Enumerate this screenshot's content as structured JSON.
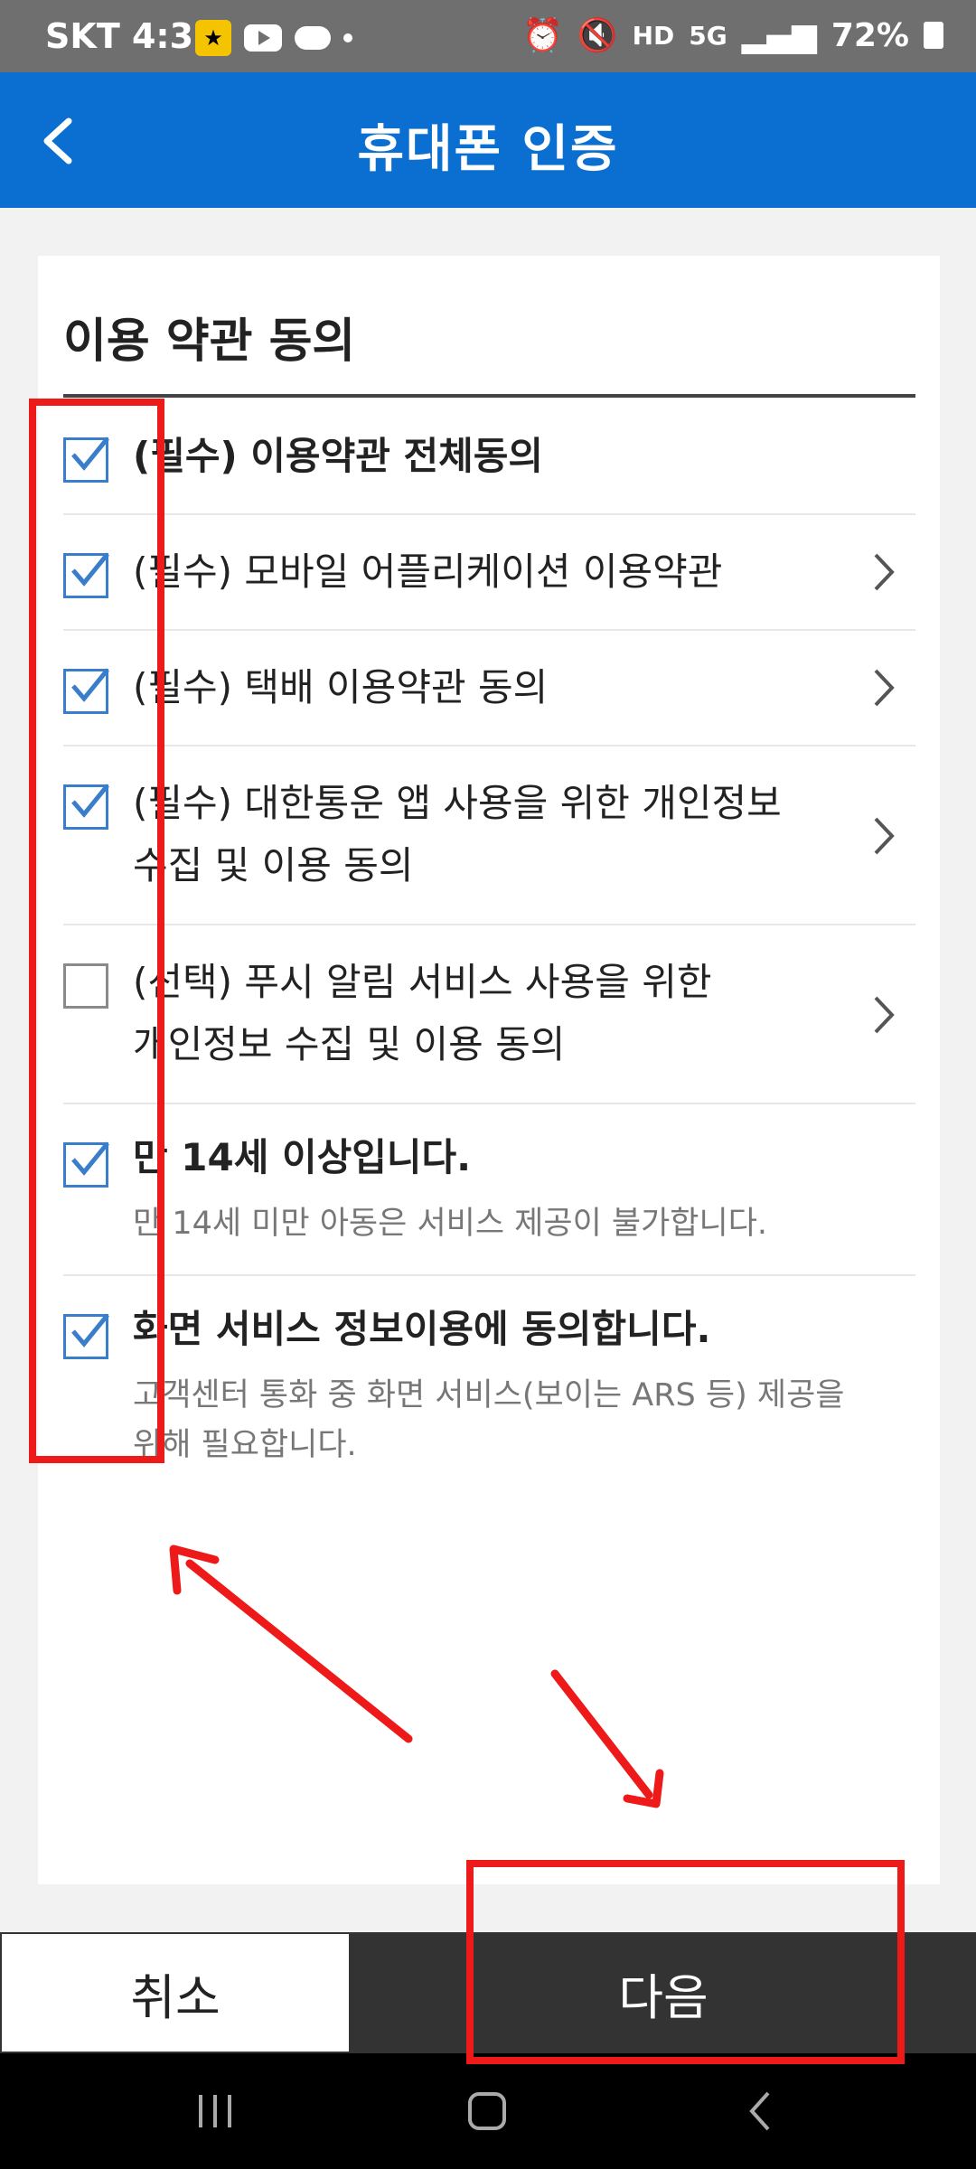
{
  "status_bar": {
    "carrier_time": "SKT 4:31",
    "network": "5G",
    "battery": "72%"
  },
  "header": {
    "title": "휴대폰 인증"
  },
  "terms": {
    "section_title": "이용 약관 동의",
    "items": [
      {
        "label": "(필수) 이용약관 전체동의",
        "checked": true,
        "bold": true,
        "has_arrow": false
      },
      {
        "label": "(필수) 모바일 어플리케이션 이용약관",
        "checked": true,
        "has_arrow": true
      },
      {
        "label": "(필수) 택배 이용약관 동의",
        "checked": true,
        "has_arrow": true
      },
      {
        "label_line1": "(필수) 대한통운 앱 사용을 위한 개인정보",
        "label_line2": "수집 및 이용 동의",
        "checked": true,
        "has_arrow": true
      },
      {
        "label_line1": "(선택) 푸시 알림 서비스 사용을 위한",
        "label_line2": "개인정보 수집 및 이용 동의",
        "checked": false,
        "has_arrow": true
      },
      {
        "label": "만 14세 이상입니다.",
        "sub": "만 14세 미만 아동은 서비스 제공이 불가합니다.",
        "checked": true,
        "bold": true
      },
      {
        "label": "화면 서비스 정보이용에 동의합니다.",
        "sub_line1": "고객센터 통화 중 화면 서비스(보이는 ARS 등) 제공을",
        "sub_line2": "위해 필요합니다.",
        "checked": true,
        "bold": true
      }
    ]
  },
  "buttons": {
    "cancel": "취소",
    "next": "다음"
  },
  "colors": {
    "header_blue": "#0a6fd0",
    "checkbox_blue": "#3a7ecb",
    "annotation_red": "#ee1a1a",
    "next_button_bg": "#333333"
  }
}
